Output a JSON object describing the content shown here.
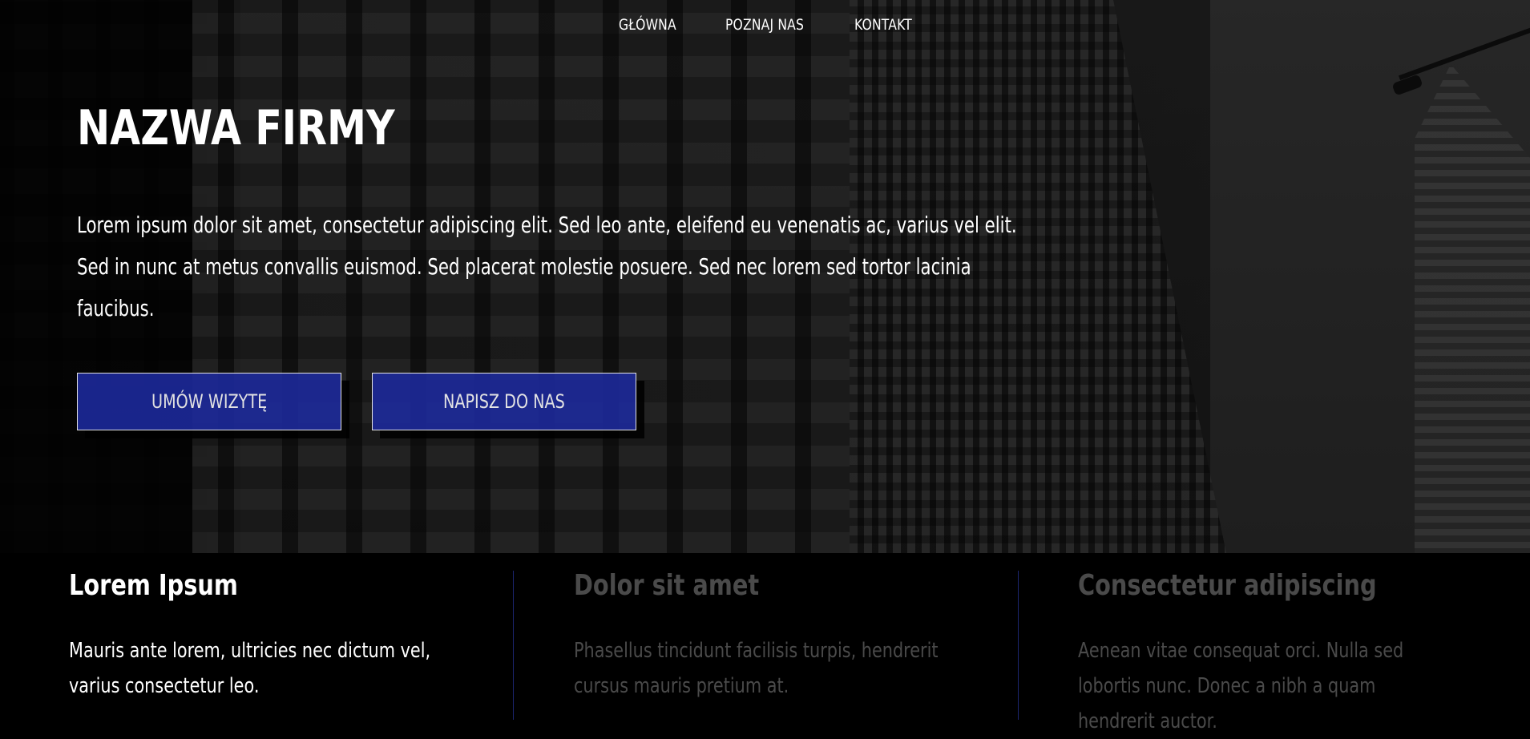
{
  "nav": {
    "items": [
      {
        "label": "GŁÓWNA"
      },
      {
        "label": "POZNAJ NAS"
      },
      {
        "label": "KONTAKT"
      }
    ]
  },
  "hero": {
    "title": "NAZWA FIRMY",
    "lead": "Lorem ipsum dolor sit amet, consectetur adipiscing elit. Sed leo ante, eleifend eu venenatis ac, varius vel elit. Sed in nunc at metus convallis euismod. Sed placerat molestie posuere. Sed nec lorem sed tortor lacinia faucibus.",
    "buttons": {
      "primary": "UMÓW WIZYTĘ",
      "secondary": "NAPISZ DO NAS"
    }
  },
  "features": [
    {
      "title": "Lorem Ipsum",
      "text": "Mauris ante lorem, ultricies nec dictum vel, varius consectetur leo."
    },
    {
      "title": "Dolor sit amet",
      "text": "Phasellus tincidunt facilisis turpis, hendrerit cursus mauris pretium at."
    },
    {
      "title": "Consectetur adipiscing",
      "text": "Aenean vitae consequat orci. Nulla sed lobortis nunc. Donec a nibh a quam hendrerit auctor."
    }
  ],
  "colors": {
    "button_bg": "#1d2a9e",
    "divider": "#1c2670",
    "muted_text": "#4a4a4a",
    "background": "#000000"
  }
}
